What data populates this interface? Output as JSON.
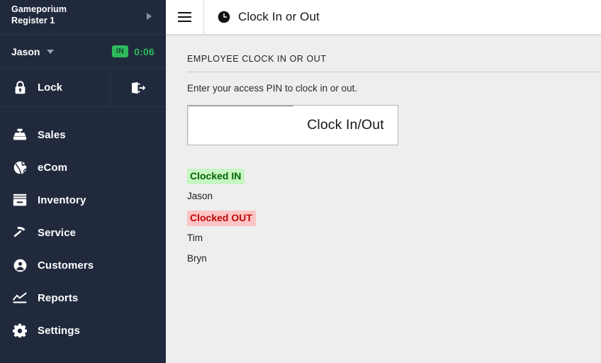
{
  "sidebar": {
    "store": {
      "store_name": "Gameporium",
      "register_name": "Register 1",
      "expand_icon": "caret-right-icon"
    },
    "user": {
      "name": "Jason",
      "dropdown_icon": "caret-down-icon",
      "status_badge": "IN",
      "timer": "0:06",
      "badge_bg": "#2eb85c",
      "timer_color": "#2eb85c"
    },
    "lock": {
      "label": "Lock",
      "lock_icon": "lock-icon",
      "logout_icon": "logout-icon"
    },
    "nav_items": [
      {
        "label": "Sales",
        "icon": "cash-register-icon"
      },
      {
        "label": "eCom",
        "icon": "globe-icon"
      },
      {
        "label": "Inventory",
        "icon": "inventory-box-icon"
      },
      {
        "label": "Service",
        "icon": "hammer-icon"
      },
      {
        "label": "Customers",
        "icon": "person-circle-icon"
      },
      {
        "label": "Reports",
        "icon": "chart-line-icon"
      },
      {
        "label": "Settings",
        "icon": "gear-icon"
      }
    ],
    "background_color": "#212a3d"
  },
  "topbar": {
    "menu_icon": "hamburger-menu-icon",
    "clock_icon": "clock-icon",
    "title": "Clock In or Out"
  },
  "main": {
    "section_title": "EMPLOYEE CLOCK IN OR OUT",
    "instruction": "Enter your access PIN to clock in or out.",
    "pin_input": {
      "value": "",
      "placeholder": ""
    },
    "clock_button_label": "Clock In/Out",
    "groups": [
      {
        "badge": "Clocked IN",
        "state": "in",
        "badge_bg": "#c6f6c1",
        "badge_color": "#086308",
        "people": [
          "Jason"
        ]
      },
      {
        "badge": "Clocked OUT",
        "state": "out",
        "badge_bg": "#fcc5c5",
        "badge_color": "#c00808",
        "people": [
          "Tim",
          "Bryn"
        ]
      }
    ]
  }
}
